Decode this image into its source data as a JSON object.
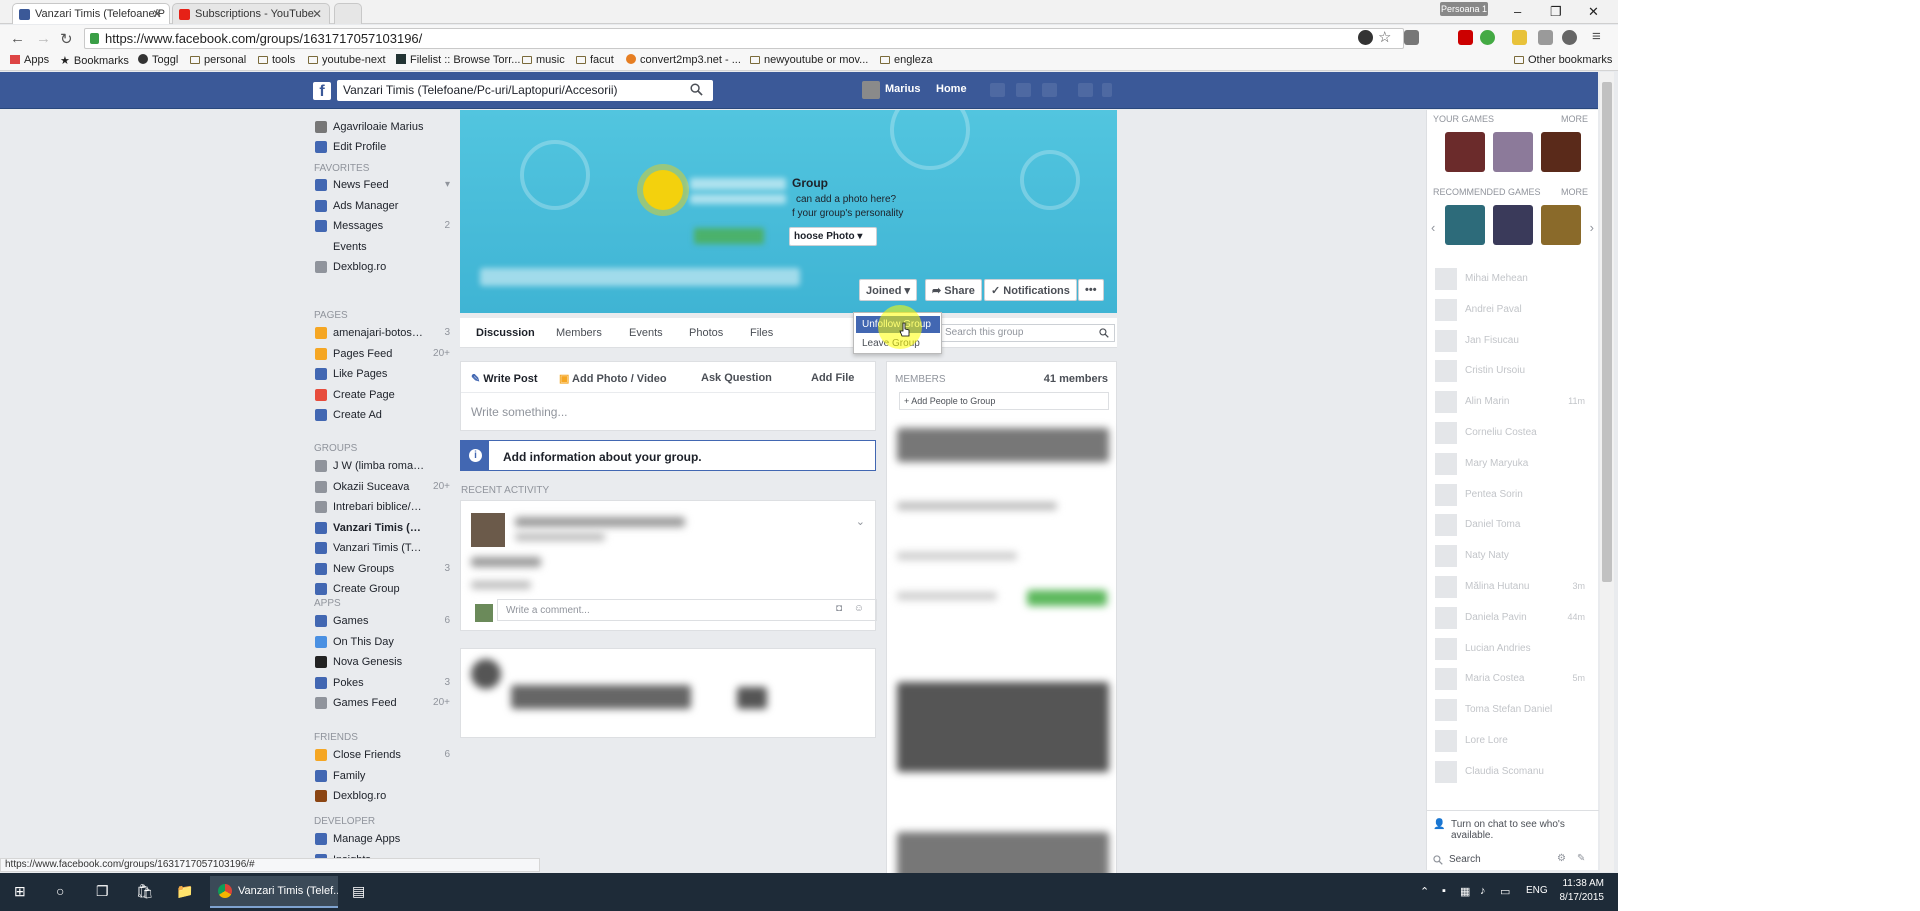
{
  "browser": {
    "tabs": [
      {
        "title": "Vanzari Timis (Telefoane/P",
        "active": true
      },
      {
        "title": "Subscriptions - YouTube",
        "active": false
      }
    ],
    "profile_badge": "Persoana 1",
    "url": "https://www.facebook.com/groups/1631717057103196/",
    "bookmarks": [
      "Apps",
      "Bookmarks",
      "Toggl",
      "personal",
      "tools",
      "youtube-next",
      "Filelist :: Browse Torr...",
      "music",
      "facut",
      "convert2mp3.net - ...",
      "newyoutube or mov...",
      "engleza"
    ],
    "other_bookmarks": "Other bookmarks",
    "status_url": "https://www.facebook.com/groups/1631717057103196/#"
  },
  "fb_header": {
    "search_value": "Vanzari Timis (Telefoane/Pc-uri/Laptopuri/Accesorii)",
    "user_name": "Marius",
    "home_label": "Home"
  },
  "leftnav": {
    "profile_name": "Agavriloaie Marius",
    "edit_profile": "Edit Profile",
    "favorites_header": "FAVORITES",
    "favorites": [
      {
        "label": "News Feed",
        "count": "▾",
        "color": "#4267b2"
      },
      {
        "label": "Ads Manager",
        "count": "",
        "color": "#4267b2"
      },
      {
        "label": "Messages",
        "count": "2",
        "color": "#4267b2"
      },
      {
        "label": "Events",
        "count": "",
        "color": "#e9ebee"
      },
      {
        "label": "Dexblog.ro",
        "count": "",
        "color": "#90949c"
      }
    ],
    "pages_header": "PAGES",
    "pages": [
      {
        "label": "amenajari-botosani...",
        "count": "3",
        "color": "#f5a623"
      },
      {
        "label": "Pages Feed",
        "count": "20+",
        "color": "#f5a623"
      },
      {
        "label": "Like Pages",
        "count": "",
        "color": "#4267b2"
      },
      {
        "label": "Create Page",
        "count": "",
        "color": "#e74c3c"
      },
      {
        "label": "Create Ad",
        "count": "",
        "color": "#4267b2"
      }
    ],
    "groups_header": "GROUPS",
    "groups": [
      {
        "label": "J W (limba romana)",
        "count": "",
        "color": "#90949c"
      },
      {
        "label": "Okazii Suceava",
        "count": "20+",
        "color": "#90949c"
      },
      {
        "label": "Intrebari biblice/Bi...",
        "count": "",
        "color": "#90949c"
      },
      {
        "label": "Vanzari Timis (Tel...",
        "count": "",
        "color": "#4267b2",
        "bold": true
      },
      {
        "label": "Vanzari Timis (Tel...",
        "count": "",
        "color": "#4267b2"
      },
      {
        "label": "New Groups",
        "count": "3",
        "color": "#4267b2"
      },
      {
        "label": "Create Group",
        "count": "",
        "color": "#4267b2"
      }
    ],
    "apps_header": "APPS",
    "apps": [
      {
        "label": "Games",
        "count": "6",
        "color": "#4267b2"
      },
      {
        "label": "On This Day",
        "count": "",
        "color": "#4a90e2"
      },
      {
        "label": "Nova Genesis",
        "count": "",
        "color": "#222"
      },
      {
        "label": "Pokes",
        "count": "3",
        "color": "#4267b2"
      },
      {
        "label": "Games Feed",
        "count": "20+",
        "color": "#90949c"
      }
    ],
    "friends_header": "FRIENDS",
    "friends": [
      {
        "label": "Close Friends",
        "count": "6",
        "color": "#f5a623"
      },
      {
        "label": "Family",
        "count": "",
        "color": "#4267b2"
      },
      {
        "label": "Dexblog.ro",
        "count": "",
        "color": "#8b4513"
      }
    ],
    "developer_header": "DEVELOPER",
    "developer": [
      {
        "label": "Manage Apps",
        "count": "",
        "color": "#4267b2"
      },
      {
        "label": "Insights",
        "count": "",
        "color": "#4267b2"
      }
    ]
  },
  "cover": {
    "title": "Group",
    "line1": "can add a photo here?",
    "line2": "f your group's personality",
    "choose_photo": "hoose Photo ▾"
  },
  "cover_actions": {
    "joined": "Joined ▾",
    "share": "Share",
    "notifications": "Notifications",
    "more": "•••"
  },
  "dropdown": {
    "unfollow": "Unfollow Group",
    "leave": "Leave Group"
  },
  "subnav": {
    "tabs": [
      "Discussion",
      "Members",
      "Events",
      "Photos",
      "Files"
    ],
    "search_placeholder": "Search this group"
  },
  "composer": {
    "actions": [
      "Write Post",
      "Add Photo / Video",
      "Ask Question",
      "Add File"
    ],
    "placeholder": "Write something..."
  },
  "info_banner": "Add information about your group.",
  "recent_activity": "RECENT ACTIVITY",
  "comment_placeholder": "Write a comment...",
  "members": {
    "header": "MEMBERS",
    "count": "41 members",
    "add_people": "+ Add People to Group"
  },
  "right_sidebar": {
    "your_games": "YOUR GAMES",
    "recommended_games": "RECOMMENDED GAMES",
    "more": "MORE",
    "chat_contacts": [
      {
        "name": "Mihai Mehean",
        "meta": ""
      },
      {
        "name": "Andrei Paval",
        "meta": ""
      },
      {
        "name": "Jan Fisucau",
        "meta": ""
      },
      {
        "name": "Cristin Ursoiu",
        "meta": ""
      },
      {
        "name": "Alin Marin",
        "meta": "11m"
      },
      {
        "name": "Corneliu Costea",
        "meta": ""
      },
      {
        "name": "Mary Maryuka",
        "meta": ""
      },
      {
        "name": "Pentea Sorin",
        "meta": ""
      },
      {
        "name": "Daniel Toma",
        "meta": ""
      },
      {
        "name": "Naty Naty",
        "meta": ""
      },
      {
        "name": "Mălina Hutanu",
        "meta": "3m"
      },
      {
        "name": "Daniela Pavin",
        "meta": "44m"
      },
      {
        "name": "Lucian Andries",
        "meta": ""
      },
      {
        "name": "Maria Costea",
        "meta": "5m"
      },
      {
        "name": "Toma Stefan Daniel",
        "meta": ""
      },
      {
        "name": "Lore Lore",
        "meta": ""
      },
      {
        "name": "Claudia Scomanu",
        "meta": ""
      }
    ],
    "chat_off_text": "Turn on chat to see who's available.",
    "chat_search": "Search"
  },
  "taskbar": {
    "active_window": "Vanzari Timis (Telef...",
    "lang": "ENG",
    "time": "11:38 AM",
    "date": "8/17/2015"
  }
}
